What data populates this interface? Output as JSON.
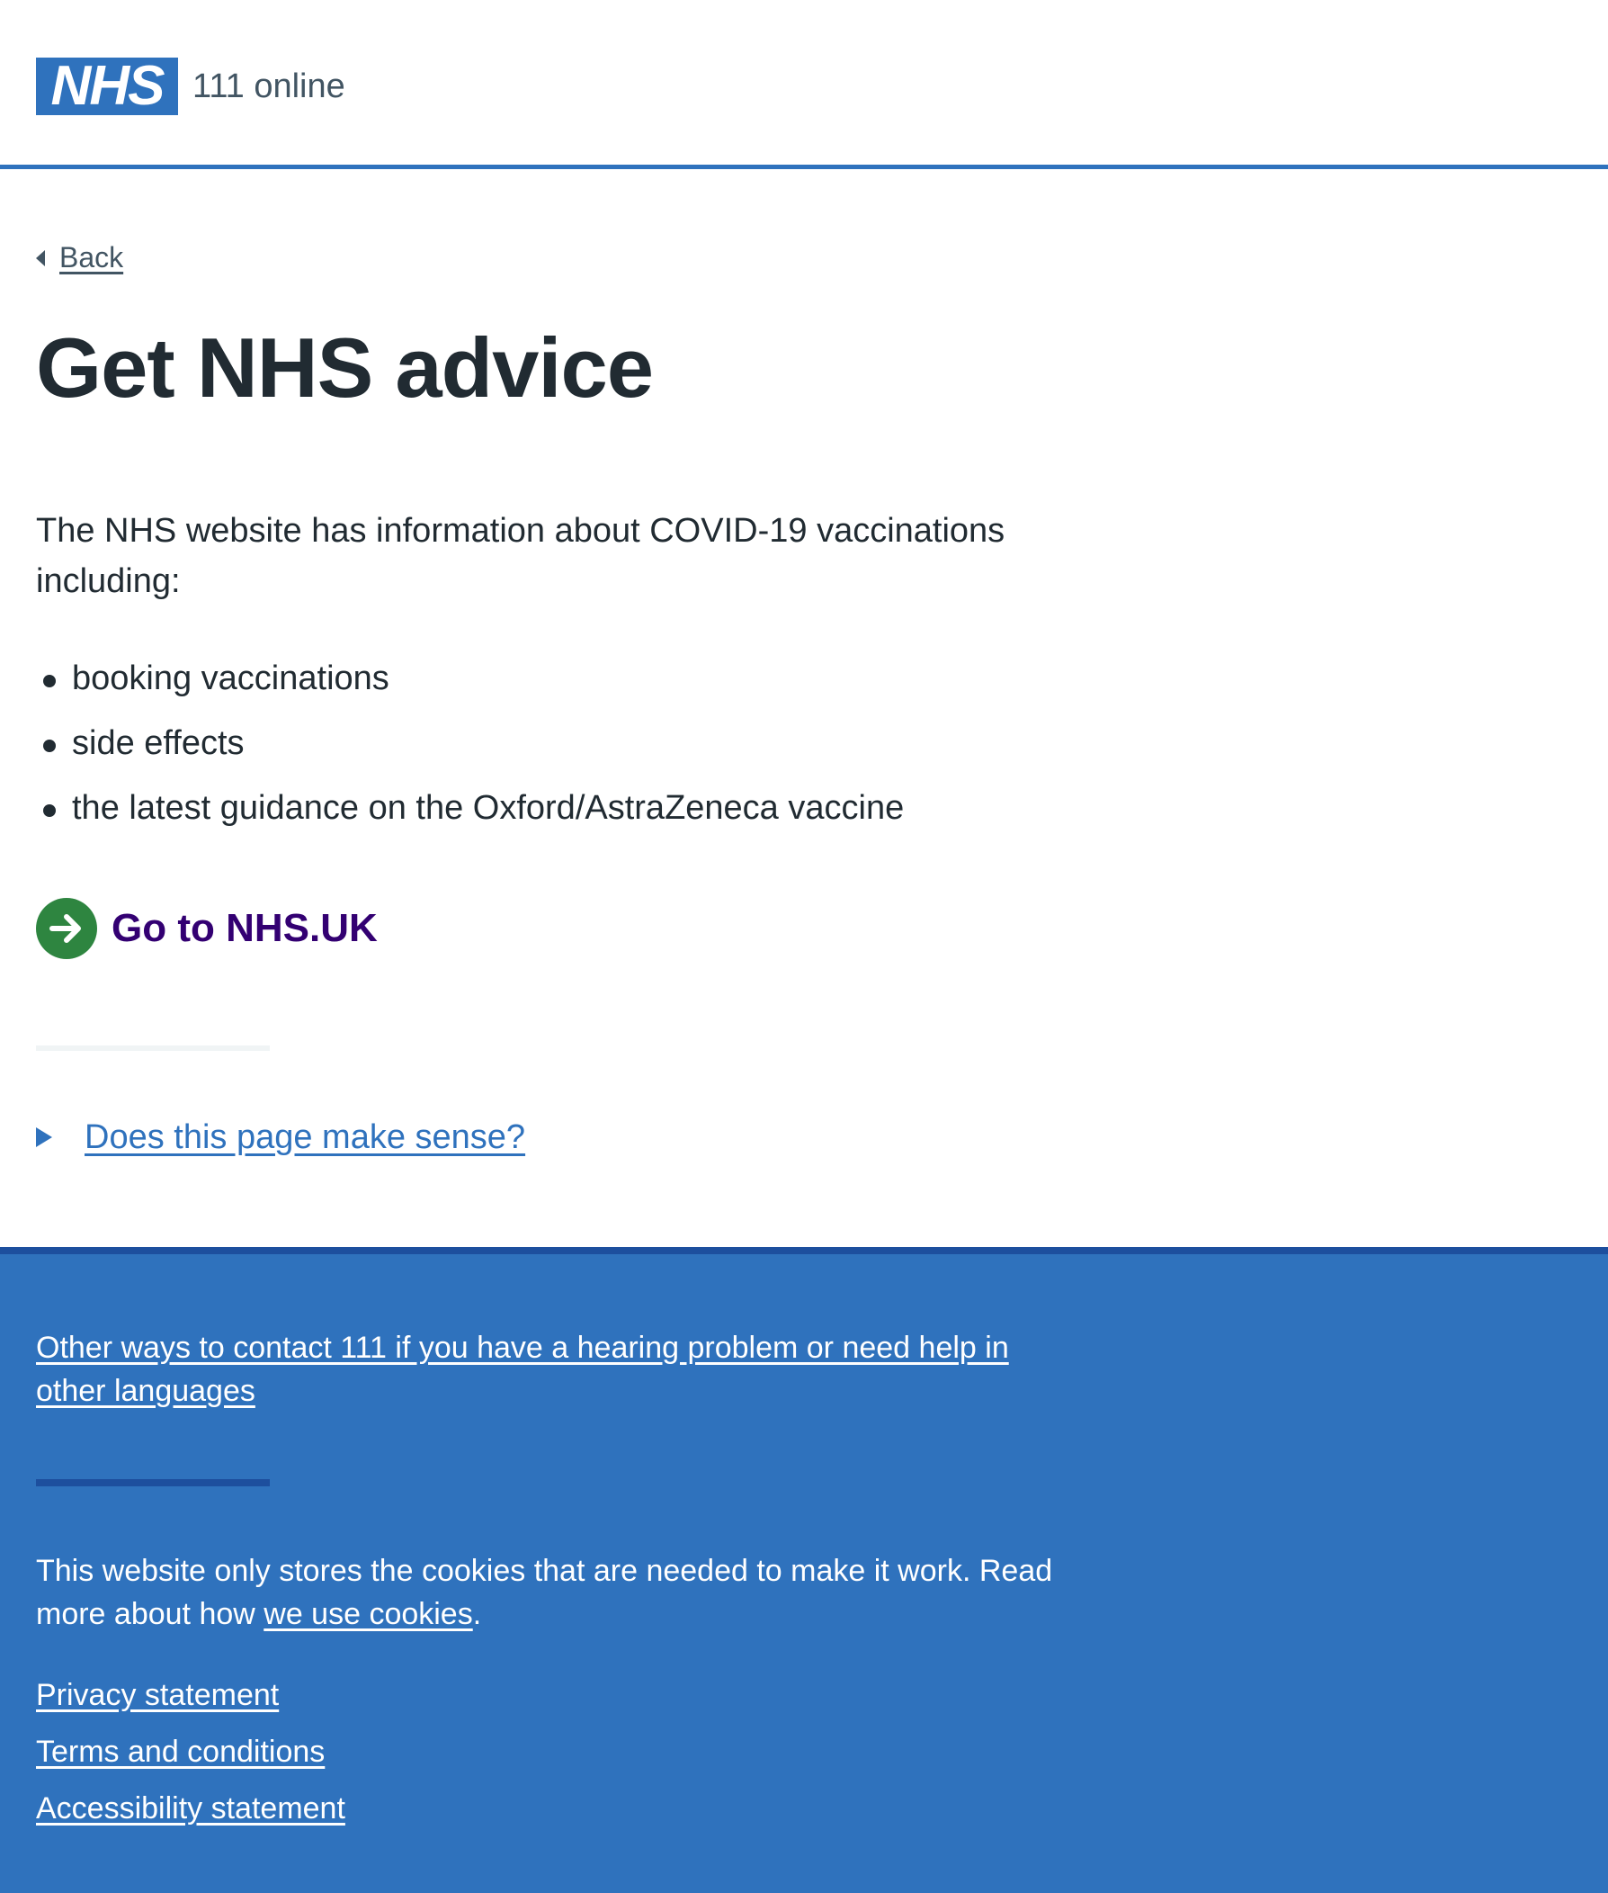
{
  "header": {
    "logo_text": "NHS",
    "service_name": "111 online"
  },
  "back": {
    "label": "Back"
  },
  "page_title": "Get NHS advice",
  "intro": "The NHS website has information about COVID-19 vaccinations including:",
  "bullets": [
    "booking vaccinations",
    "side effects",
    "the latest guidance on the Oxford/AstraZeneca vaccine"
  ],
  "action_link": {
    "label": "Go to NHS.UK",
    "icon": "arrow-right-circle-icon",
    "icon_color": "#2e8540",
    "text_color": "#330072"
  },
  "feedback": {
    "label": "Does this page make sense?"
  },
  "footer": {
    "contact_link": "Other ways to contact 111 if you have a hearing problem or need help in other languages",
    "cookies_text": "This website only stores the cookies that are needed to make it work. Read more about how",
    "cookies_link": "we use cookies",
    "cookies_end": ".",
    "links": [
      "Privacy statement",
      "Terms and conditions",
      "Accessibility statement"
    ]
  },
  "colors": {
    "brand_blue": "#2f72bd",
    "text": "#212b32",
    "footer_rule": "#1d4f9e"
  }
}
